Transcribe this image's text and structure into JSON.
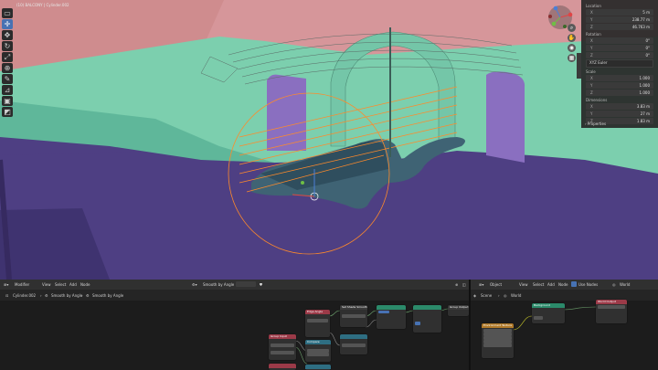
{
  "viewport": {
    "object_info_lines": [
      "",
      "(10) BALCONY | Cylinder.002"
    ],
    "tools": [
      "select-box-icon",
      "cursor-icon",
      "move-icon",
      "rotate-icon",
      "scale-icon",
      "transform-icon",
      "annotate-icon",
      "measure-icon",
      "add-cube-icon",
      "modifier-icon"
    ],
    "nav_buttons": [
      "zoom-icon",
      "hand-icon",
      "camera-icon",
      "grid-icon"
    ]
  },
  "n_panel": {
    "location_title": "Location",
    "location": [
      {
        "axis": "X",
        "value": "5 m"
      },
      {
        "axis": "Y",
        "value": "238.77 m"
      },
      {
        "axis": "Z",
        "value": "46.763 m"
      }
    ],
    "rotation_title": "Rotation",
    "rotation": [
      {
        "axis": "X",
        "value": "0°"
      },
      {
        "axis": "Y",
        "value": "0°"
      },
      {
        "axis": "Z",
        "value": "0°"
      }
    ],
    "rotation_mode": "XYZ Euler",
    "scale_title": "Scale",
    "scale": [
      {
        "axis": "X",
        "value": "1.000"
      },
      {
        "axis": "Y",
        "value": "1.000"
      },
      {
        "axis": "Z",
        "value": "1.000"
      }
    ],
    "dimensions_title": "Dimensions",
    "dimensions": [
      {
        "axis": "X",
        "value": "3.83 m"
      },
      {
        "axis": "Y",
        "value": "27 m"
      },
      {
        "axis": "Z",
        "value": "1.83 m"
      }
    ],
    "properties_label": "Properties"
  },
  "node_editor_left": {
    "editor_type": "Modifier",
    "menus": [
      "View",
      "Select",
      "Add",
      "Node"
    ],
    "node_group": "Smooth by Angle",
    "breadcrumb": [
      "Cylinder.002",
      "Smooth by Angle",
      "Smooth by Angle"
    ],
    "nodes": [
      {
        "title": "Group Input"
      },
      {
        "title": "Edge Angle"
      },
      {
        "title": "Compare"
      },
      {
        "title": "Set Shade Smooth"
      },
      {
        "title": "Group Output"
      }
    ]
  },
  "node_editor_right": {
    "editor_type": "Object",
    "menus": [
      "View",
      "Select",
      "Add",
      "Node"
    ],
    "use_nodes_label": "Use Nodes",
    "world_name": "World",
    "breadcrumb": [
      "Scene",
      "World"
    ],
    "nodes": [
      {
        "title": "Environment Texture"
      },
      {
        "title": "Background"
      },
      {
        "title": "World Output"
      }
    ]
  },
  "colors": {
    "wall_pink": "#d6969a",
    "teal": "#7ccfae",
    "floor_purple": "#4e3f83",
    "pillar_purple": "#8a6fc0",
    "selection_orange": "#ff8a2a"
  }
}
